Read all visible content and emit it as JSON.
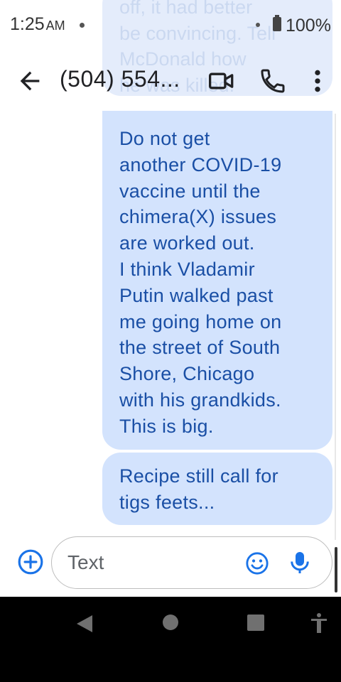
{
  "status_bar": {
    "time": "1:25",
    "ampm": "AM",
    "battery": "100%"
  },
  "header": {
    "contact": "(504) 554..."
  },
  "previous_message_fragment": "off, it had better\nbe convincing. Tell\nMcDonald how\nhe was killed.",
  "messages": [
    {
      "text": "Do not get\nanother COVID-19\nvaccine until the\nchimera(X) issues\nare worked out.\nI think Vladamir\nPutin walked past\nme going home on\nthe street of South\nShore, Chicago\nwith his grandkids.\nThis is big."
    },
    {
      "text": "Recipe still call for\ntigs feets..."
    }
  ],
  "compose": {
    "placeholder": "Text"
  },
  "colors": {
    "bubble_background": "#d3e3fd",
    "bubble_text": "#1a4fa5",
    "accent": "#1a73e8"
  },
  "icons": [
    "back-arrow-icon",
    "video-call-icon",
    "phone-icon",
    "more-vert-icon",
    "add-circle-icon",
    "emoji-icon",
    "microphone-icon",
    "nav-back-icon",
    "nav-home-icon",
    "nav-recents-icon",
    "accessibility-icon"
  ]
}
